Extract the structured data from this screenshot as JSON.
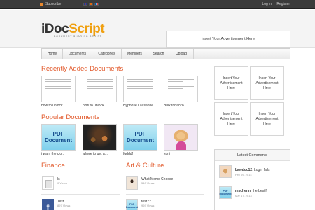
{
  "topbar": {
    "subscribe": "Subscribe",
    "login": "Log in",
    "separator": "|",
    "register": "Register"
  },
  "header": {
    "logo_prefix": "iDoc",
    "logo_suffix": "Script",
    "tagline": "DOCUMENT SHARING SCRIPT",
    "ad_text": "Insert Your Advertisement Here"
  },
  "nav": [
    "Home",
    "Documents",
    "Categories",
    "Members",
    "Search",
    "Upload"
  ],
  "recent": {
    "title": "Recently Added Documents",
    "items": [
      "how to unlock ...",
      "how to unlock ...",
      "Hypnose Lausanne",
      "Bulk tobacco"
    ]
  },
  "popular": {
    "title": "Popular Documents",
    "items": [
      {
        "caption": "i want the clo...",
        "kind": "pdf",
        "line1": "PDF",
        "line2": "Document"
      },
      {
        "caption": "where to get a...",
        "kind": "stage",
        "line1": "",
        "line2": ""
      },
      {
        "caption": "fgdddf",
        "kind": "pdf",
        "line1": "PDF",
        "line2": "Document"
      },
      {
        "caption": "konj",
        "kind": "photo",
        "line1": "",
        "line2": ""
      }
    ]
  },
  "finance": {
    "title": "Finance",
    "items": [
      {
        "title": "ls",
        "meta": "0 Views"
      },
      {
        "title": "Test",
        "meta": "897 Views"
      }
    ]
  },
  "arts": {
    "title": "Art & Culture",
    "items": [
      {
        "title": "What Moms Choose",
        "meta": "540 Views"
      },
      {
        "title": "test??",
        "meta": "969 Views"
      }
    ]
  },
  "side_ads": [
    "Insert Your Advertisement Here",
    "Insert Your Advertisement Here",
    "Insert Your Advertisement Here",
    "Insert Your Advertisement Here"
  ],
  "comments": {
    "title": "Latest Comments",
    "items": [
      {
        "user": "Lawdoc12",
        "text": "Login fails",
        "date": "Feb 09, 2014"
      },
      {
        "user": "mschenn",
        "text": "the bestl!!",
        "date": "Mar 17, 2013"
      }
    ]
  },
  "mini_pdf": {
    "line1": "PDF",
    "line2": "Document"
  },
  "colors": {
    "accent": "#e2592b",
    "logo_orange": "#f0a010",
    "topbar": "#3c3c3c"
  }
}
